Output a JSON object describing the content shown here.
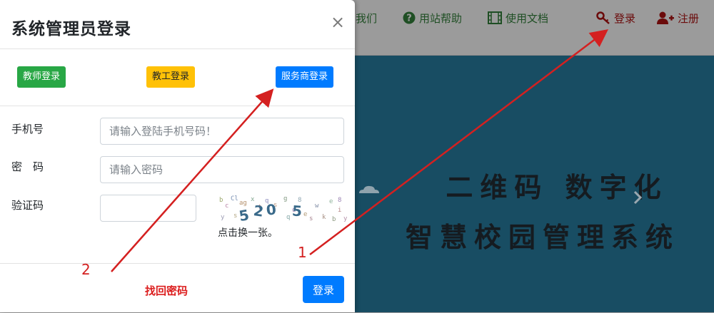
{
  "nav": {
    "about_label": "我们",
    "help_label": "用站帮助",
    "docs_label": "使用文档",
    "login_label": "登录",
    "register_label": "注册"
  },
  "banner": {
    "line1": "二维码 数字化",
    "line2": "智慧校园管理系统"
  },
  "modal": {
    "title": "系统管理员登录",
    "close_symbol": "×",
    "roles": {
      "teacher": "教师登录",
      "staff": "教工登录",
      "provider": "服务商登录"
    },
    "fields": {
      "phone_label": "手机号",
      "phone_placeholder": "请输入登陆手机号码！",
      "phone_value": "",
      "password_label": "密　码",
      "password_placeholder": "请输入密码",
      "password_value": "",
      "captcha_label": "验证码",
      "captcha_value": ""
    },
    "captcha_code": "5205",
    "captcha_hint": "点击换一张。",
    "forgot_label": "找回密码",
    "submit_label": "登录"
  },
  "annotations": {
    "marker_1": "1",
    "marker_2": "2"
  },
  "colors": {
    "teacher_button": "#28a745",
    "staff_button": "#ffc107",
    "primary": "#007bff",
    "annotation_red": "#d42020",
    "banner_bg": "#184d63"
  },
  "icons": {
    "help": "question-circle-icon",
    "docs": "film-icon",
    "login": "key-icon",
    "register": "user-plus-icon",
    "close": "close-icon"
  }
}
